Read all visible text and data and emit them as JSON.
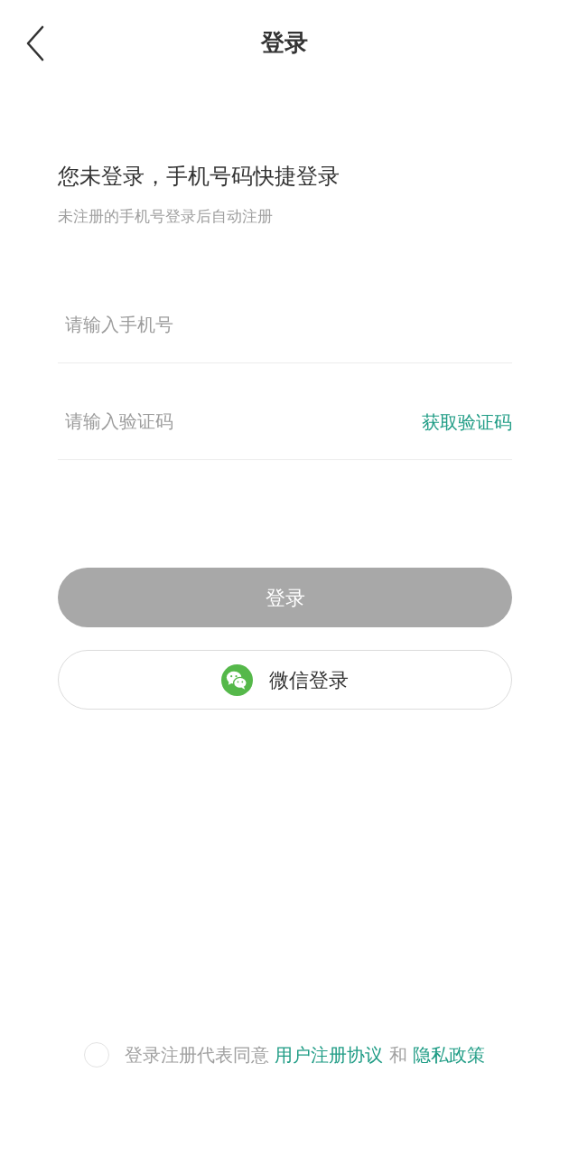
{
  "header": {
    "title": "登录"
  },
  "intro": {
    "heading": "您未登录，手机号码快捷登录",
    "subheading": "未注册的手机号登录后自动注册"
  },
  "fields": [
    {
      "placeholder": "请输入手机号"
    },
    {
      "placeholder": "请输入验证码",
      "action": "获取验证码"
    }
  ],
  "login_button": {
    "label": "登录",
    "disabled": true
  },
  "wechat_button": {
    "label": "微信登录"
  },
  "agreement": {
    "checked": false,
    "parts": [
      {
        "kind": "text",
        "text": "登录注册代表同意"
      },
      {
        "kind": "link",
        "text": "用户注册协议"
      },
      {
        "kind": "text",
        "text": "和"
      },
      {
        "kind": "link",
        "text": "隐私政策"
      }
    ]
  }
}
